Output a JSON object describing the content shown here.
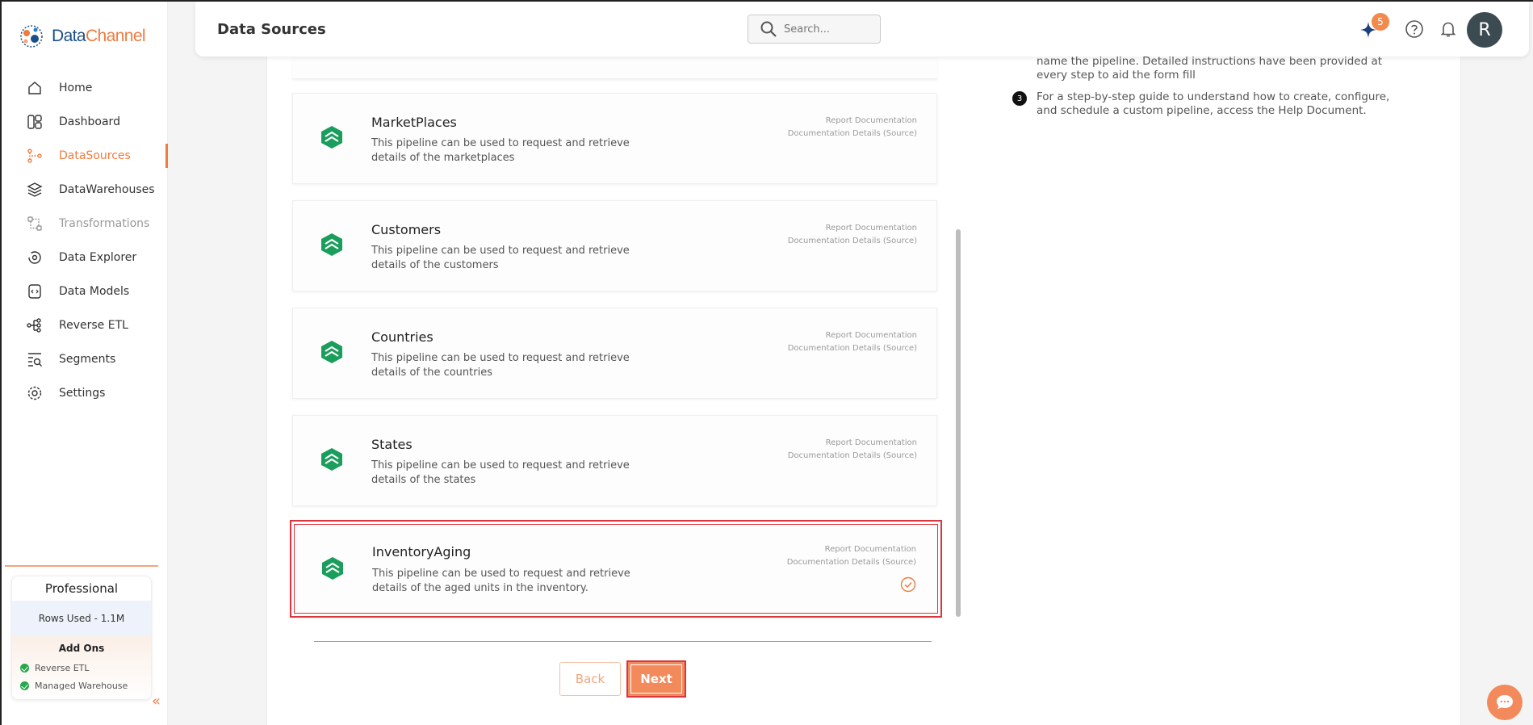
{
  "brand": {
    "name_part1": "Data",
    "name_part2": "Channel"
  },
  "sidebar": {
    "items": [
      {
        "label": "Home",
        "icon": "home-icon",
        "state": "normal"
      },
      {
        "label": "Dashboard",
        "icon": "dashboard-icon",
        "state": "normal"
      },
      {
        "label": "DataSources",
        "icon": "datasources-icon",
        "state": "active"
      },
      {
        "label": "DataWarehouses",
        "icon": "datawarehouses-icon",
        "state": "normal"
      },
      {
        "label": "Transformations",
        "icon": "transformations-icon",
        "state": "muted"
      },
      {
        "label": "Data Explorer",
        "icon": "data-explorer-icon",
        "state": "normal"
      },
      {
        "label": "Data Models",
        "icon": "data-models-icon",
        "state": "normal"
      },
      {
        "label": "Reverse ETL",
        "icon": "reverse-etl-icon",
        "state": "normal"
      },
      {
        "label": "Segments",
        "icon": "segments-icon",
        "state": "normal"
      },
      {
        "label": "Settings",
        "icon": "settings-icon",
        "state": "normal"
      }
    ],
    "plan": {
      "title": "Professional",
      "rows_used": "Rows Used - 1.1M",
      "addons_title": "Add Ons",
      "addons": [
        "Reverse ETL",
        "Managed Warehouse"
      ]
    },
    "collapse_glyph": "«"
  },
  "header": {
    "title": "Data Sources",
    "search_placeholder": "Search...",
    "notification_badge": "5",
    "avatar_initial": "R"
  },
  "pipelines": [
    {
      "name": "MarketPlaces",
      "desc": "This pipeline can be used to request and retrieve details of the marketplaces",
      "link1": "Report Documentation",
      "link2": "Documentation Details (Source)",
      "selected": false
    },
    {
      "name": "Customers",
      "desc": "This pipeline can be used to request and retrieve details of the customers",
      "link1": "Report Documentation",
      "link2": "Documentation Details (Source)",
      "selected": false
    },
    {
      "name": "Countries",
      "desc": "This pipeline can be used to request and retrieve details of the countries",
      "link1": "Report Documentation",
      "link2": "Documentation Details (Source)",
      "selected": false
    },
    {
      "name": "States",
      "desc": "This pipeline can be used to request and retrieve details of the states",
      "link1": "Report Documentation",
      "link2": "Documentation Details (Source)",
      "selected": false
    },
    {
      "name": "InventoryAging",
      "desc": "This pipeline can be used to request and retrieve details of the aged units in the inventory.",
      "link1": "Report Documentation",
      "link2": "Documentation Details (Source)",
      "selected": true
    }
  ],
  "buttons": {
    "back": "Back",
    "next": "Next"
  },
  "instructions": {
    "partial_text": "name the pipeline. Detailed instructions have been provided at every step to aid the form fill",
    "step3_number": "3",
    "step3_text": "For a step-by-step guide to understand how to create, configure, and schedule a custom pipeline, access the Help Document."
  },
  "colors": {
    "accent": "#f07b3f",
    "brand_blue": "#1b4f8a",
    "pipeline_green": "#1a9e5c",
    "selected_border": "#d9363e"
  }
}
